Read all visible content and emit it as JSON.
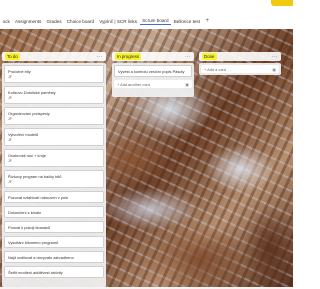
{
  "tabs": [
    "ock",
    "Assignments",
    "Grades",
    "Choice board",
    "Vypínč | SCR links",
    "Scrum board",
    "Bellonce test"
  ],
  "tab_add": "+",
  "active_tab_index": 5,
  "columns": {
    "todo": {
      "title": "To do",
      "menu": "···",
      "cards": [
        {
          "text": "Pročotné bity",
          "badge": "JF"
        },
        {
          "text": "Kolizovo Dotolické paměsty",
          "badge": "JF"
        },
        {
          "text": "Organizování podspésly",
          "badge": "JF"
        },
        {
          "text": "Vytvoření modelů",
          "badge": "JF"
        },
        {
          "text": "Osobnosti rusí + kroje",
          "badge": "JF"
        },
        {
          "text": "Řízkový program na bačky bitů",
          "badge": "JF"
        },
        {
          "text": "Pozovat vztahlosti rubouven v pole"
        },
        {
          "text": "Dokončení s kmalu"
        },
        {
          "text": "Pouvat k pokoji kbanáců"
        },
        {
          "text": "Vyscitání bliomeno programů"
        },
        {
          "text": "Najít vzdilovat a dovyvato zahradbeno"
        },
        {
          "text": "Šetřit modlení additivest arkivity"
        }
      ]
    },
    "in_progress": {
      "title": "In progress",
      "menu": "···",
      "cards": [
        {
          "text": "Vyvést a kontrolu vesíční popis Pasuty"
        }
      ],
      "add_label": "+ Add another card"
    },
    "done": {
      "title": "Done",
      "menu": "···",
      "add_label": "+ Add a card"
    }
  }
}
